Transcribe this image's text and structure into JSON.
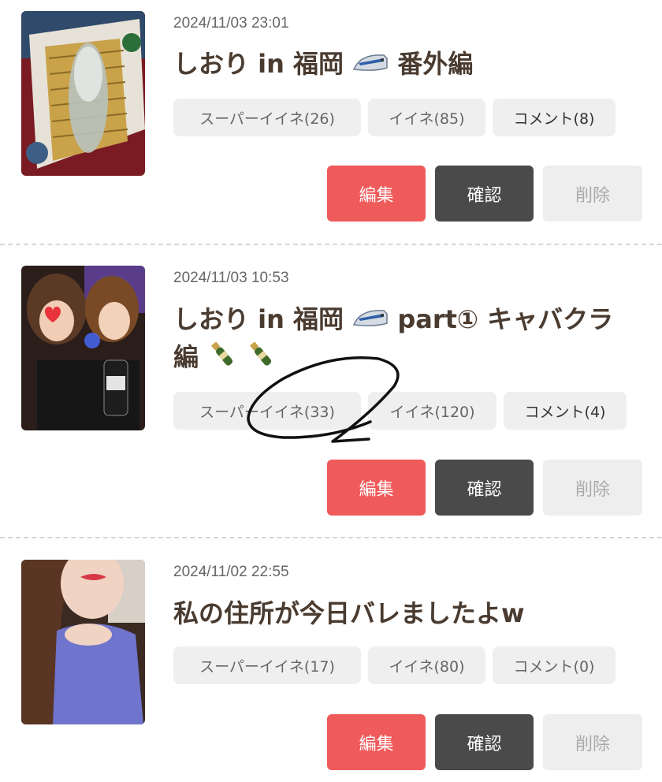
{
  "posts": [
    {
      "date": "2024/11/03 23:01",
      "title_text": "しおり in 福岡",
      "title_suffix": "番外編",
      "title_line2": "",
      "tags": {
        "super_like": "スーパーイイネ(26)",
        "like": "イイネ(85)",
        "comment": "コメント(8)"
      },
      "buttons": {
        "edit": "編集",
        "confirm": "確認",
        "delete": "削除"
      }
    },
    {
      "date": "2024/11/03 10:53",
      "title_text": "しおり in 福岡",
      "title_suffix": "part① キャバクラ",
      "title_line2": "編",
      "tags": {
        "super_like": "スーパーイイネ(33)",
        "like": "イイネ(120)",
        "comment": "コメント(4)"
      },
      "buttons": {
        "edit": "編集",
        "confirm": "確認",
        "delete": "削除"
      }
    },
    {
      "date": "2024/11/02 22:55",
      "title_text": "私の住所が今日バレましたよw",
      "title_suffix": "",
      "title_line2": "",
      "tags": {
        "super_like": "スーパーイイネ(17)",
        "like": "イイネ(80)",
        "comment": "コメント(0)"
      },
      "buttons": {
        "edit": "編集",
        "confirm": "確認",
        "delete": "削除"
      }
    }
  ],
  "icons": {
    "train": "bullet-train-emoji",
    "champagne": "champagne-emoji"
  },
  "colors": {
    "edit": "#ef5a5a",
    "confirm": "#4a4a4a",
    "delete_bg": "#eeeeee",
    "tag_bg": "#efefef",
    "title": "#4a3b30"
  }
}
